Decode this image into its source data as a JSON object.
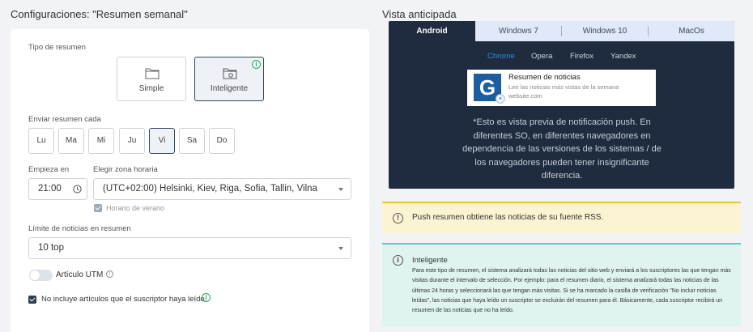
{
  "left": {
    "title": "Configuraciones: \"Resumen semanal\"",
    "summary_type_label": "Tipo de resumen",
    "types": [
      {
        "label": "Simple",
        "selected": false
      },
      {
        "label": "Inteligente",
        "selected": true
      }
    ],
    "send_every_label": "Enviar resumen cada",
    "days": [
      {
        "label": "Lu",
        "selected": false
      },
      {
        "label": "Ma",
        "selected": false
      },
      {
        "label": "Mi",
        "selected": false
      },
      {
        "label": "Ju",
        "selected": false
      },
      {
        "label": "Vi",
        "selected": true
      },
      {
        "label": "Sa",
        "selected": false
      },
      {
        "label": "Do",
        "selected": false
      }
    ],
    "starts_label": "Empieza en",
    "start_time": "21:00",
    "timezone_label": "Elegir zona horaria",
    "timezone_value": "(UTC+02:00) Helsinki, Kiev, Riga, Sofia, Tallin, Vilna",
    "dst_label": "Horario de verano",
    "dst_checked": true,
    "limit_label": "Límite de noticias en resumen",
    "limit_value": "10 top",
    "utm_label": "Artículo UTM",
    "utm_enabled": false,
    "exclude_read_label": "No incluye artículos que el suscriptor haya leído.",
    "exclude_read_checked": true
  },
  "right": {
    "title": "Vista anticipada",
    "os_tabs": [
      "Android",
      "Windows 7",
      "Windows 10",
      "MacOs"
    ],
    "active_os": "Android",
    "browsers": [
      "Chrome",
      "Opera",
      "Firefox",
      "Yandex"
    ],
    "active_browser": "Chrome",
    "notification": {
      "title": "Resumen de noticias",
      "body": "Lee las noticias más vistas de la semana",
      "site": "website.com"
    },
    "disclaimer": "*Esto es vista previa de notificación push. En diferentes SO, en diferentes navegadores en dependencia de las versiones de los sistemas / de los navegadores pueden tener insignificante diferencia.",
    "warning_text": "Push resumen obtiene las noticias de su fuente RSS.",
    "info_title": "Inteligente",
    "info_body": "Para este tipo de resumen, el sistema analizará todas las noticias del sitio web y enviará a los suscriptores las que tengan más visitas durante el intervalo de selección. Por ejemplo: para el resumen diario, el sistema analizará todas las noticias de las últimas 24 horas y seleccionará las que tengan más visitas. Si se ha marcado la casilla de verificación \"No incluir noticias leídas\", las noticias que haya leído un suscriptor se excluirán del resumen para él. Básicamente, cada suscriptor recibirá un resumen de las noticias que no ha leído."
  },
  "colors": {
    "accent_dark": "#34495e",
    "preview_bg": "#1f2b3e",
    "checkbox": "#2c3e50",
    "checkbox_disabled": "#9aa9b9",
    "info_green": "#27ae60",
    "browser_active": "#2f8fe8"
  },
  "icons": [
    "folder-icon",
    "folder-gear-icon",
    "info-icon",
    "clock-icon",
    "chevron-down-icon",
    "bell-icon",
    "warning-icon"
  ]
}
